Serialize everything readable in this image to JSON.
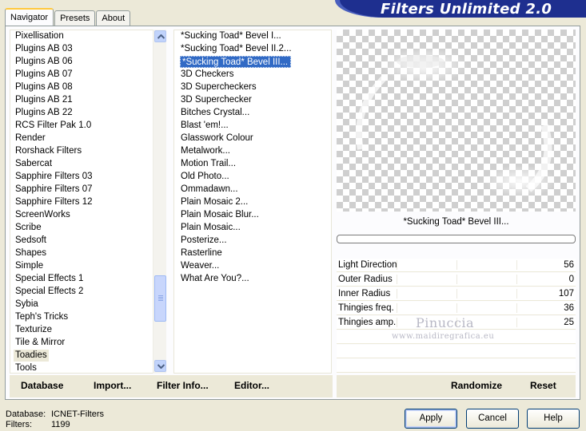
{
  "tabs": [
    {
      "label": "Navigator",
      "active": true
    },
    {
      "label": "Presets",
      "active": false
    },
    {
      "label": "About",
      "active": false
    }
  ],
  "banner_title": "Filters Unlimited 2.0",
  "categories": [
    "Pixellisation",
    "Plugins AB 03",
    "Plugins AB 06",
    "Plugins AB 07",
    "Plugins AB 08",
    "Plugins AB 21",
    "Plugins AB 22",
    "RCS Filter Pak 1.0",
    "Render",
    "Rorshack Filters",
    "Sabercat",
    "Sapphire Filters 03",
    "Sapphire Filters 07",
    "Sapphire Filters 12",
    "ScreenWorks",
    "Scribe",
    "Sedsoft",
    "Shapes",
    "Simple",
    "Special Effects 1",
    "Special Effects 2",
    "Sybia",
    "Teph's Tricks",
    "Texturize",
    "Tile & Mirror",
    "Toadies",
    "Tools"
  ],
  "selected_category": "Toadies",
  "filters": [
    "*Sucking Toad*  Bevel I...",
    "*Sucking Toad*  Bevel II.2...",
    "*Sucking Toad*  Bevel III...",
    "3D Checkers",
    "3D Supercheckers",
    "3D Superchecker",
    "Bitches Crystal...",
    "Blast 'em!...",
    "Glasswork Colour",
    "Metalwork...",
    "Motion Trail...",
    "Old Photo...",
    "Ommadawn...",
    "Plain Mosaic 2...",
    "Plain Mosaic Blur...",
    "Plain Mosaic...",
    "Posterize...",
    "Rasterline",
    "Weaver...",
    "What Are You?..."
  ],
  "selected_filter": "*Sucking Toad*  Bevel III...",
  "preview_filter_name": "*Sucking Toad*  Bevel III...",
  "params": [
    {
      "name": "Light Direction",
      "value": "56"
    },
    {
      "name": "Outer Radius",
      "value": "0"
    },
    {
      "name": "Inner Radius",
      "value": "107"
    },
    {
      "name": "Thingies freq.",
      "value": "36"
    },
    {
      "name": "Thingies amp.",
      "value": "25"
    }
  ],
  "watermark": {
    "line1": "Pinuccia",
    "line2": "www.maidiregrafica.eu"
  },
  "toolbar": {
    "database": "Database",
    "import": "Import...",
    "filter_info": "Filter Info...",
    "editor": "Editor...",
    "randomize": "Randomize",
    "reset": "Reset"
  },
  "status": {
    "database_label": "Database:",
    "database_value": "ICNET-Filters",
    "filters_label": "Filters:",
    "filters_value": "1199"
  },
  "buttons": {
    "apply": "Apply",
    "cancel": "Cancel",
    "help": "Help"
  },
  "colors": {
    "banner": "#1e2f8f",
    "selection": "#316ac5",
    "window": "#ece9d8"
  },
  "icons": {
    "scroll_up": "chevron-up-icon",
    "scroll_down": "chevron-down-icon"
  }
}
